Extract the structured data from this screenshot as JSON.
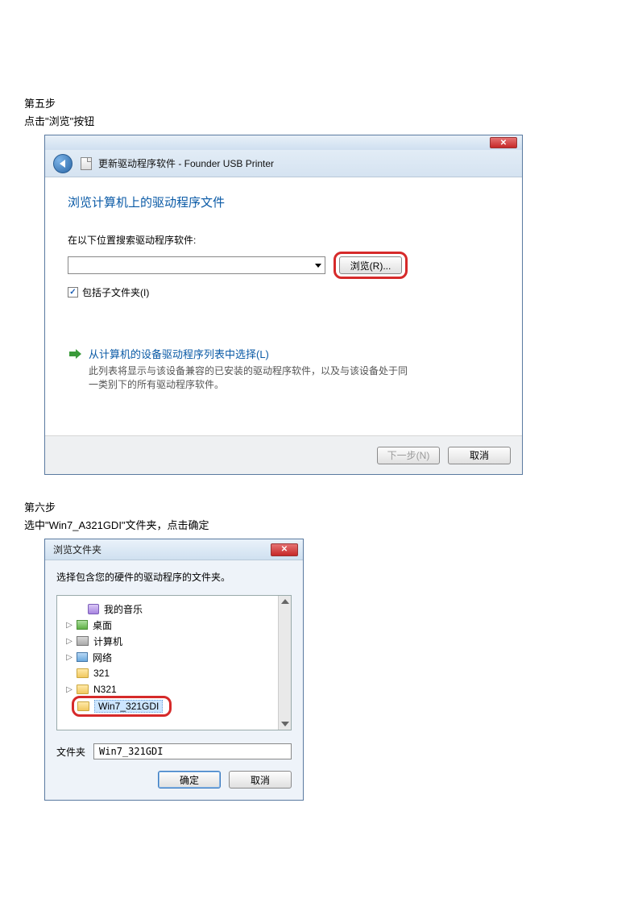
{
  "step5": {
    "heading": "第五步",
    "desc": "点击\"浏览\"按钮"
  },
  "dialog1": {
    "header_text": "更新驱动程序软件 - Founder USB Printer",
    "title": "浏览计算机上的驱动程序文件",
    "search_label": "在以下位置搜索驱动程序软件:",
    "combo_value": "",
    "browse_btn": "浏览(R)...",
    "include_sub": "包括子文件夹(I)",
    "pick_title": "从计算机的设备驱动程序列表中选择(L)",
    "pick_desc": "此列表将显示与该设备兼容的已安装的驱动程序软件，以及与该设备处于同一类别下的所有驱动程序软件。",
    "next_btn": "下一步(N)",
    "cancel_btn": "取消"
  },
  "step6": {
    "heading": "第六步",
    "desc": "选中\"Win7_A321GDI\"文件夹，点击确定"
  },
  "dialog2": {
    "title": "浏览文件夹",
    "instr": "选择包含您的硬件的驱动程序的文件夹。",
    "tree": {
      "my_music": "我的音乐",
      "desktop": "桌面",
      "computer": "计算机",
      "network": "网络",
      "f321": "321",
      "n321": "N321",
      "win7": "Win7_321GDI"
    },
    "folder_label": "文件夹",
    "folder_value": "Win7_321GDI",
    "ok_btn": "确定",
    "cancel_btn": "取消"
  }
}
